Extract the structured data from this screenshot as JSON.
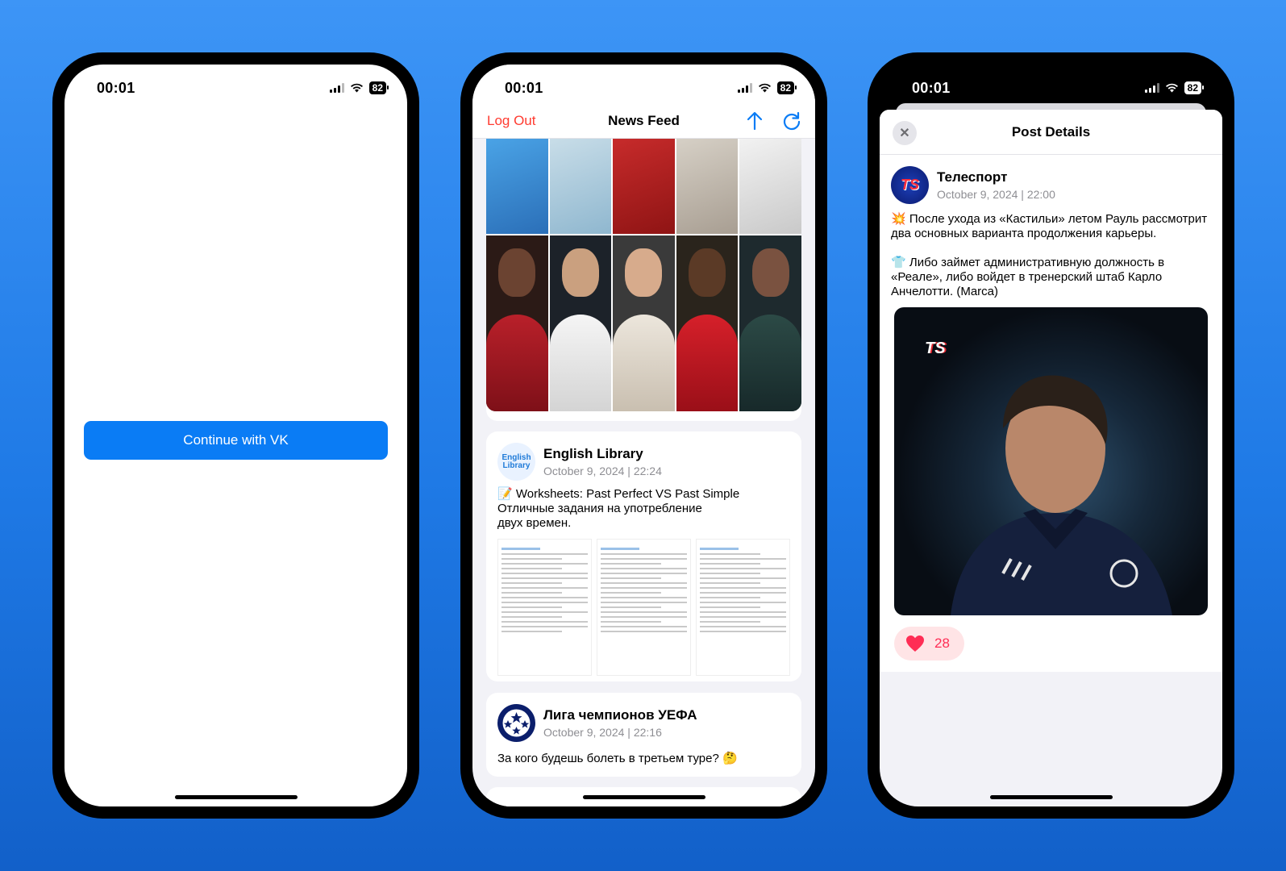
{
  "status": {
    "time": "00:01",
    "battery": "82"
  },
  "login": {
    "button_label": "Continue with VK"
  },
  "feed": {
    "nav": {
      "logout_label": "Log Out",
      "title": "News Feed"
    },
    "posts": [
      {
        "author": "English Library",
        "date": "October 9, 2024 | 22:24",
        "avatar_text": "English Library",
        "text": "📝 Worksheets: Past Perfect VS Past Simple\nОтличные задания на употребление\nдвух времен."
      },
      {
        "author": "Лига чемпионов УЕФА",
        "date": "October 9, 2024 | 22:16",
        "text": "За кого будешь болеть в третьем туре? 🤔"
      }
    ]
  },
  "details": {
    "title": "Post Details",
    "author": "Телеспорт",
    "avatar_text": "TS",
    "date": "October 9, 2024 | 22:00",
    "text": "💥 После ухода из «Кастильи» летом Рауль рассмотрит два основных варианта продолжения карьеры.\n\n👕 Либо займет административную должность в «Реале», либо войдет в тренерский штаб Карло Анчелотти. (Marca)",
    "photo_logo": "TS",
    "likes": "28"
  },
  "colors": {
    "accent": "#0a7cf5",
    "destructive": "#ff3b30",
    "like": "#ff2d55"
  }
}
